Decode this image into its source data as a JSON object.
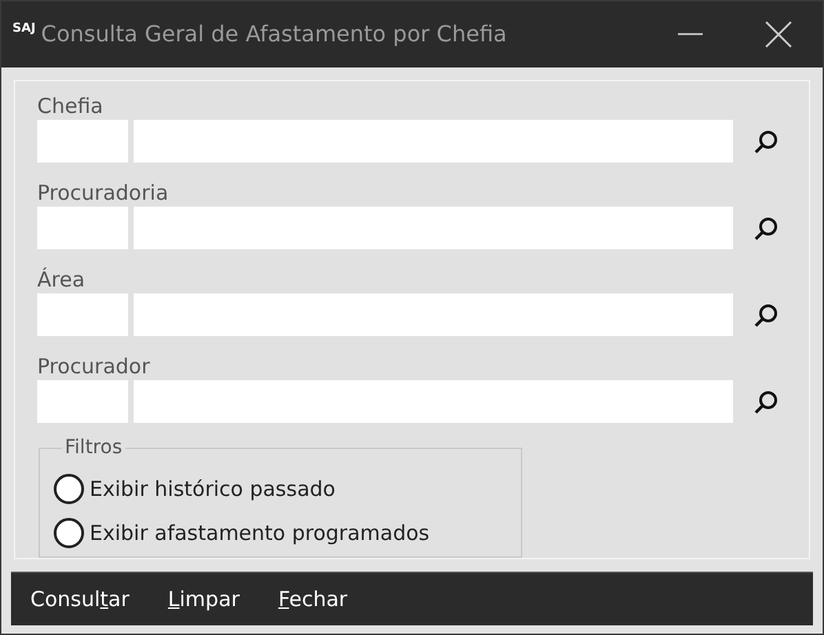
{
  "window": {
    "logo": "SAJ",
    "title": "Consulta Geral de Afastamento por Chefia"
  },
  "fields": [
    {
      "label": "Chefia"
    },
    {
      "label": "Procuradoria"
    },
    {
      "label": "Área"
    },
    {
      "label": "Procurador"
    }
  ],
  "filters": {
    "title": "Filtros",
    "options": [
      {
        "label": "Exibir histórico passado",
        "selected": false
      },
      {
        "label": "Exibir afastamento programados",
        "selected": false
      }
    ]
  },
  "buttons": [
    {
      "before": "Consul",
      "key": "t",
      "after": "ar"
    },
    {
      "key": "L",
      "after": "impar"
    },
    {
      "key": "F",
      "after": "echar"
    }
  ]
}
